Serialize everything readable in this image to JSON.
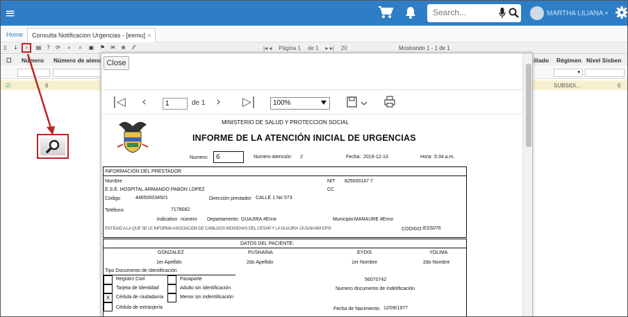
{
  "topbar": {
    "search_placeholder": "Search...",
    "user_name": "MARTHA LILIANA",
    "menu_icon": "hamburger-icon",
    "cart_icon": "cart-icon",
    "bell_icon": "bell-icon",
    "gear_icon": "gear-icon"
  },
  "tabs": {
    "home": "Home",
    "active": "Consulta Notificacion Urgencias - [eemu]",
    "close": "×"
  },
  "toolbar": {
    "page_label": "Página 1",
    "of_label": "de 1",
    "page_size": "20",
    "showing": "Mostrando 1 - 1 de 1"
  },
  "grid": {
    "headers": [
      "Número",
      "Número de atenci",
      "iliado",
      "Régimen",
      "Nivel Sisben"
    ],
    "row": {
      "col1": "6",
      "regimen": "SUBSIDI...",
      "nivel": "0"
    }
  },
  "modal": {
    "close": "Close",
    "viewer": {
      "page_value": "1",
      "of_label": "de 1",
      "zoom": "100%"
    },
    "doc": {
      "ministry": "MINISTERIO DE SALUD Y PROTECCION SOCIAL",
      "title": "INFORME DE LA ATENCIÓN INICIAL DE URGENCIAS",
      "numero_label": "Numero:",
      "numero_value": "6",
      "numero_atencion_label": "Numero Atención:",
      "numero_atencion_value": "2",
      "fecha_label": "Fecha:",
      "fecha_value": "2019-12-13",
      "hora_label": "Hora:",
      "hora_value": "5:34 a.m.",
      "prestador_header": "INFORMACIÓN DEL PRESTADOR",
      "nombre_label": "Nombre",
      "nombre_value": "E.S.E. HOSPITAL ARMANDO PABON LOPEZ",
      "nit_label": "NIT",
      "nit_value": "825000147 7",
      "cc_label": "CC",
      "codigo_label": "Código",
      "codigo_value": "446500034501",
      "direccion_label": "Dirección prestador",
      "direccion_value": "CALLE 1 No 573",
      "telefono_label": "Teléfono:",
      "telefono_value": "7178082",
      "indicativo_label": "indicativo",
      "numero_lbl": "número",
      "departamento_label": "Departamento:",
      "departamento_value": "GUAJIRA #Error",
      "municipio_label": "Municipio:",
      "municipio_value": "MANAURE #Error",
      "entidad_text": "ENTIDAD A LA QUE SE LE INFORMA ASOCIACION DE CABILDOS INDIGENAS DEL CESAR Y LA GUAJIRA -DUSAKAWI EPSI",
      "codigo2_label": "CODIGO:",
      "codigo2_value": "ESS076",
      "paciente_header": "DATOS DEL PACIENTE:",
      "apellido1": "GONZALEZ",
      "apellido2": "PUSHAINA",
      "nombre1": "EYDIS",
      "nombre2": "YOLIMA",
      "apellido1_label": "1er Apellido",
      "apellido2_label": "2do Apellido",
      "nombre1_label": "1er Nombre",
      "nombre2_label": "2do Nombre",
      "tipo_doc_label": "Tipo Documento de Identificación",
      "registro_civil": "Registro Civil",
      "tarjeta": "Tarjeta de Identidad",
      "cedula": "Cédula de ciudadanía",
      "cedula_ext": "Cédula de extranjería",
      "pasaporte": "Pasaporte",
      "adulto": "Adulto sin identificación",
      "menor": "Menor sin indentificación",
      "cedula_mark": "X",
      "doc_numero_value": "56070742",
      "doc_numero_label": "Numero documento de Indetificación",
      "fecha_nac_label": "Fecha de Nacimiento",
      "fecha_nac_value": "12/09/1977"
    }
  }
}
